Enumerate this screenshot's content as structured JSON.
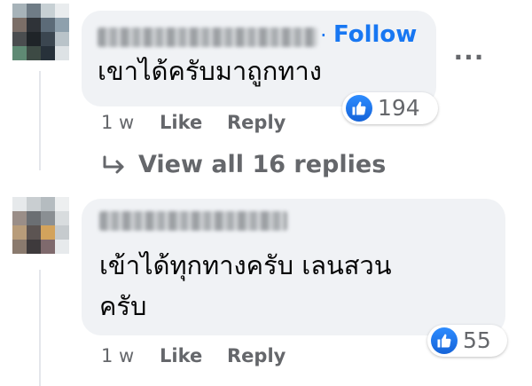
{
  "colors": {
    "accent": "#1877f2",
    "bubble": "#f0f2f5",
    "muted": "#65676b"
  },
  "comment_1": {
    "author_separator": "·",
    "follow_label": "Follow",
    "text": "เขาได้ครับมาถูกทาง",
    "more_label": "...",
    "reaction_icon": "like-icon",
    "reaction_count": "194",
    "time": "1 w",
    "like_label": "Like",
    "reply_label": "Reply"
  },
  "view_replies": {
    "icon": "reply-arrow-icon",
    "label": "View all 16 replies"
  },
  "comment_2": {
    "text_line_1": "เข้าได้ทุกทางครับ เลนสวน",
    "text_line_2": "ครับ",
    "reaction_icon": "like-icon",
    "reaction_count": "55",
    "time": "1 w",
    "like_label": "Like",
    "reply_label": "Reply"
  }
}
